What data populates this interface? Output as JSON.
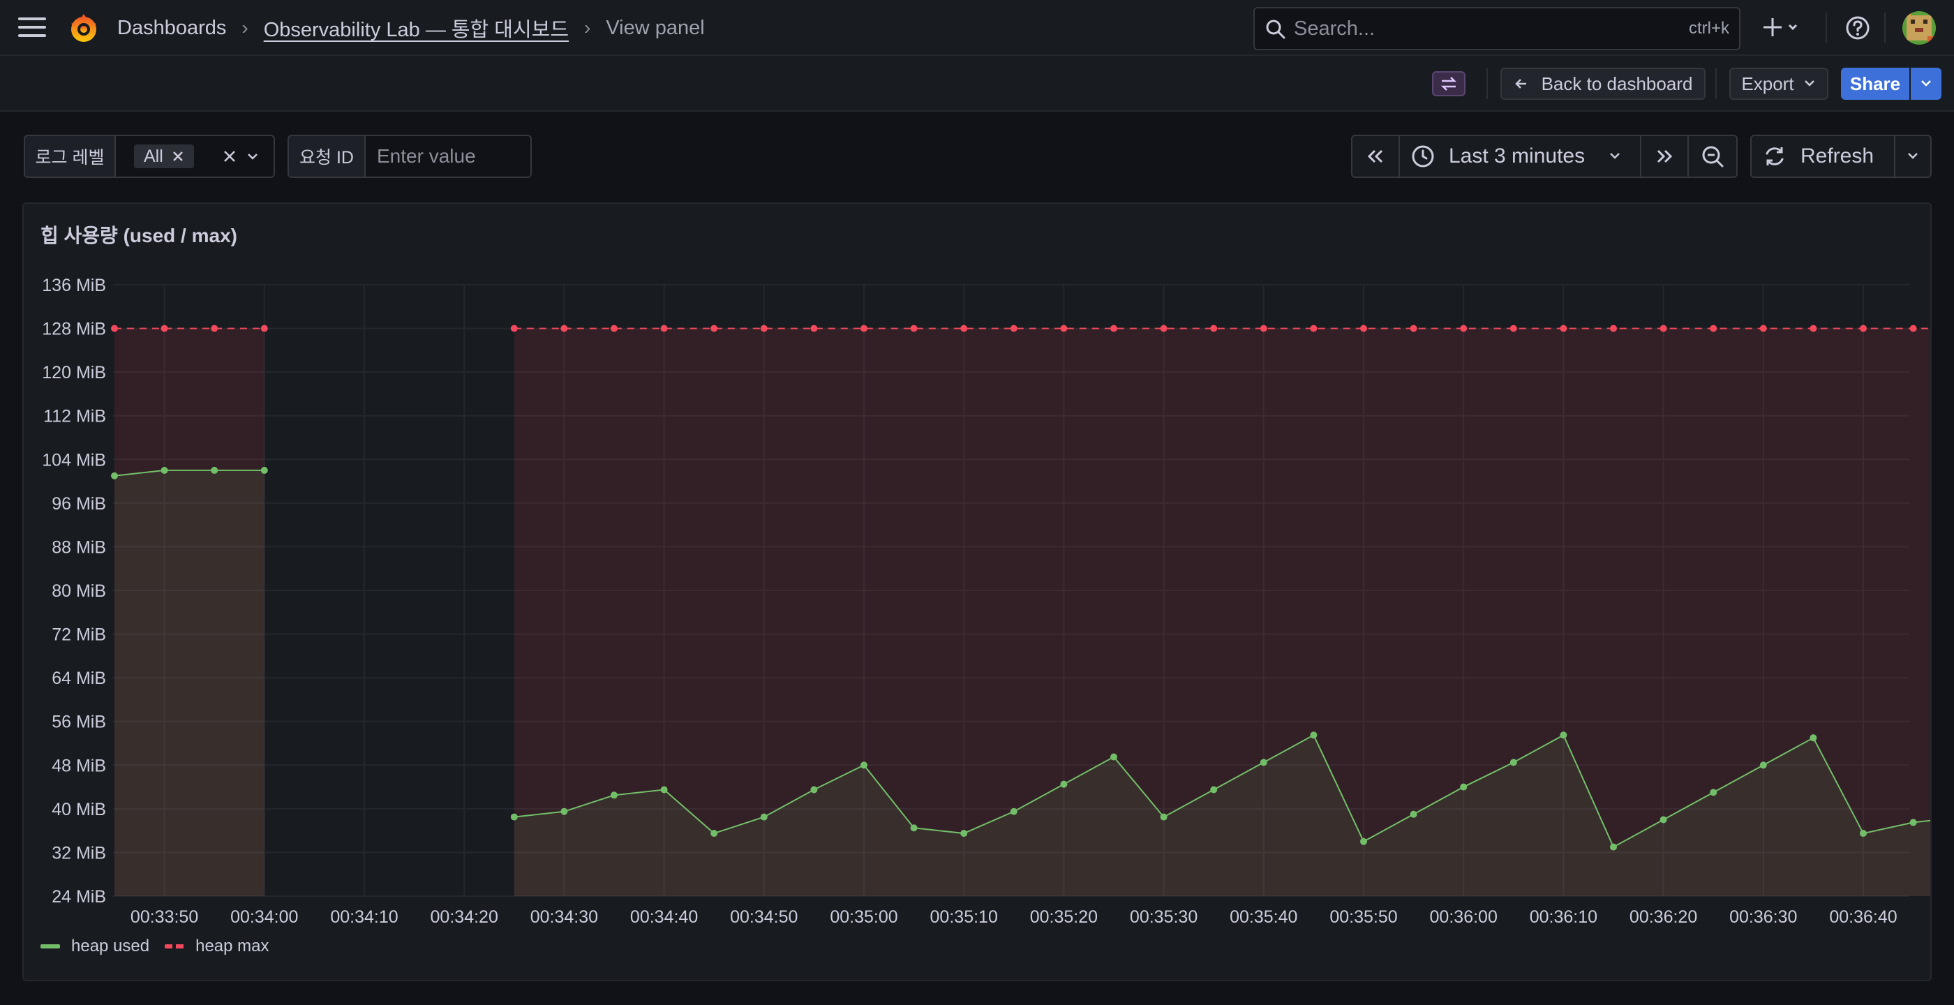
{
  "header": {
    "breadcrumbs": [
      "Dashboards",
      "Observability Lab — 통합 대시보드",
      "View panel"
    ],
    "search_placeholder": "Search...",
    "search_shortcut": "ctrl+k"
  },
  "toolbar": {
    "back_label": "Back to dashboard",
    "export_label": "Export",
    "share_label": "Share"
  },
  "variables": {
    "log_level_label": "로그 레벨",
    "log_level_value": "All",
    "request_id_label": "요청 ID",
    "request_id_placeholder": "Enter value"
  },
  "time": {
    "range_label": "Last 3 minutes",
    "refresh_label": "Refresh"
  },
  "panel": {
    "title": "힙 사용량 (used / max)"
  },
  "colors": {
    "heap_used": "#73bf69",
    "heap_max": "#f2495c",
    "primary": "#3d71d9"
  },
  "chart_data": {
    "type": "line",
    "title": "힙 사용량 (used / max)",
    "y_unit": "MiB",
    "ylim": [
      24,
      136
    ],
    "y_ticks": [
      "136 MiB",
      "128 MiB",
      "120 MiB",
      "112 MiB",
      "104 MiB",
      "96 MiB",
      "88 MiB",
      "80 MiB",
      "72 MiB",
      "64 MiB",
      "56 MiB",
      "48 MiB",
      "40 MiB",
      "32 MiB",
      "24 MiB"
    ],
    "x_ticks": [
      "00:33:50",
      "00:34:00",
      "00:34:10",
      "00:34:20",
      "00:34:30",
      "00:34:40",
      "00:34:50",
      "00:35:00",
      "00:35:10",
      "00:35:20",
      "00:35:30",
      "00:35:40",
      "00:35:50",
      "00:36:00",
      "00:36:10",
      "00:36:20",
      "00:36:30",
      "00:36:40"
    ],
    "x_start": "00:33:45",
    "x_step_seconds": 5,
    "grid": true,
    "legend_placement": "bottom-left",
    "series": [
      {
        "name": "heap used",
        "color": "#73bf69",
        "fill": true,
        "values": [
          101,
          102,
          102,
          102,
          null,
          null,
          null,
          null,
          38.5,
          39.5,
          42.5,
          43.5,
          35.5,
          38.5,
          43.5,
          48,
          36.5,
          35.5,
          39.5,
          44.5,
          49.5,
          38.5,
          43.5,
          48.5,
          53.5,
          34,
          39,
          44,
          48.5,
          53.5,
          33,
          38,
          43,
          48,
          53,
          35.5,
          37.5,
          38.5
        ]
      },
      {
        "name": "heap max",
        "color": "#f2495c",
        "dashed": true,
        "fill": true,
        "values": [
          128,
          128,
          128,
          128,
          null,
          null,
          null,
          null,
          128,
          128,
          128,
          128,
          128,
          128,
          128,
          128,
          128,
          128,
          128,
          128,
          128,
          128,
          128,
          128,
          128,
          128,
          128,
          128,
          128,
          128,
          128,
          128,
          128,
          128,
          128,
          128,
          128,
          128
        ]
      }
    ]
  }
}
